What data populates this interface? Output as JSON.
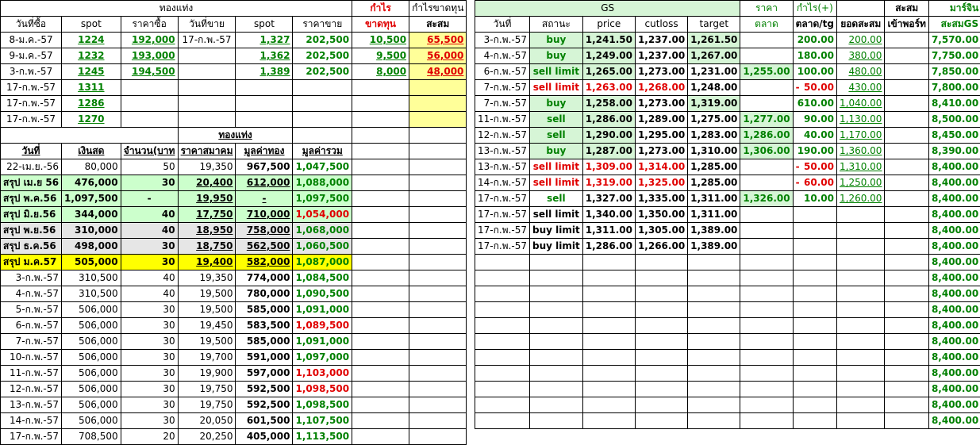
{
  "left": {
    "group_header": "ทองแท่ง",
    "group_profit": "กำไร",
    "group_profit_cum": "กำไรขาดทุน",
    "headers": [
      "วันที่ซื้อ",
      "spot",
      "ราคาซื้อ",
      "วันที่ขาย",
      "spot",
      "ราคาขาย",
      "ขาดทุน",
      "สะสม"
    ],
    "trades": [
      [
        "8-ม.ค.-57",
        "1224",
        "192,000",
        "17-ก.พ.-57",
        "1,327",
        "202,500",
        "10,500",
        "65,500"
      ],
      [
        "9-ม.ค.-57",
        "1232",
        "193,000",
        "",
        "1,362",
        "202,500",
        "9,500",
        "56,000"
      ],
      [
        "3-ก.พ.-57",
        "1245",
        "194,500",
        "",
        "1,389",
        "202,500",
        "8,000",
        "48,000"
      ],
      [
        "17-ก.พ.-57",
        "1311",
        "",
        "",
        "",
        "",
        "",
        ""
      ],
      [
        "17-ก.พ.-57",
        "1286",
        "",
        "",
        "",
        "",
        "",
        ""
      ],
      [
        "17-ก.พ.-57",
        "1270",
        "",
        "",
        "",
        "",
        "",
        ""
      ]
    ],
    "summary_group": "ทองแท่ง",
    "summary_headers": [
      "วันที่",
      "เงินสด",
      "จำนวน(บาท",
      "ราคาสมาคม",
      "มูลค่าทอง",
      "มูลค่ารวม"
    ],
    "summary_rows": [
      [
        "22-เม.ย.-56",
        "80,000",
        "50",
        "19,350",
        "967,500",
        "1,047,500"
      ],
      [
        "สรุป เม.ย 56",
        "476,000",
        "30",
        "20,400",
        "612,000",
        "1,088,000"
      ],
      [
        "สรุป พ.ค.56",
        "1,097,500",
        "-",
        "19,950",
        "-",
        "1,097,500"
      ],
      [
        "สรุป มิ.ย.56",
        "344,000",
        "40",
        "17,750",
        "710,000",
        "1,054,000"
      ],
      [
        "สรุป พ.ย.56",
        "310,000",
        "40",
        "18,950",
        "758,000",
        "1,068,000"
      ],
      [
        "สรุป ธ.ค.56",
        "498,000",
        "30",
        "18,750",
        "562,500",
        "1,060,500"
      ],
      [
        "สรุป ม.ค.57",
        "505,000",
        "30",
        "19,400",
        "582,000",
        "1,087,000"
      ],
      [
        "3-ก.พ.-57",
        "310,500",
        "40",
        "19,350",
        "774,000",
        "1,084,500"
      ],
      [
        "4-ก.พ.-57",
        "310,500",
        "40",
        "19,500",
        "780,000",
        "1,090,500"
      ],
      [
        "5-ก.พ.-57",
        "506,000",
        "30",
        "19,500",
        "585,000",
        "1,091,000"
      ],
      [
        "6-ก.พ.-57",
        "506,000",
        "30",
        "19,450",
        "583,500",
        "1,089,500"
      ],
      [
        "7-ก.พ.-57",
        "506,000",
        "30",
        "19,500",
        "585,000",
        "1,091,000"
      ],
      [
        "10-ก.พ.-57",
        "506,000",
        "30",
        "19,700",
        "591,000",
        "1,097,000"
      ],
      [
        "11-ก.พ.-57",
        "506,000",
        "30",
        "19,900",
        "597,000",
        "1,103,000"
      ],
      [
        "12-ก.พ.-57",
        "506,000",
        "30",
        "19,750",
        "592,500",
        "1,098,500"
      ],
      [
        "13-ก.พ.-57",
        "506,000",
        "30",
        "19,750",
        "592,500",
        "1,098,500"
      ],
      [
        "14-ก.พ.-57",
        "506,000",
        "30",
        "20,050",
        "601,500",
        "1,107,500"
      ],
      [
        "17-ก.พ.-57",
        "708,500",
        "20",
        "20,250",
        "405,000",
        "1,113,500"
      ]
    ]
  },
  "right": {
    "group_header": "GS",
    "price_group": "ราคา",
    "price_sub": "ตลาด",
    "profit_group": "กำไร(+)",
    "cum_group": "สะสม",
    "margin_group": "มาร์จิน",
    "headers": [
      "วันที่",
      "สถานะ",
      "price",
      "cutloss",
      "target",
      "",
      "ตลาด/tg",
      "ยอดสะสม",
      "เข้าพอร์ท",
      "สะสมGS"
    ],
    "rows": [
      [
        "3-ก.พ.-57",
        "buy",
        "1,241.50",
        "1,237.00",
        "1,261.50",
        "",
        "200.00",
        "200.00",
        "",
        "7,570.00"
      ],
      [
        "4-ก.พ.-57",
        "buy",
        "1,249.00",
        "1,237.00",
        "1,267.00",
        "",
        "180.00",
        "380.00",
        "",
        "7,750.00"
      ],
      [
        "6-ก.พ.-57",
        "sell limit",
        "1,265.00",
        "1,273.00",
        "1,231.00",
        "1,255.00",
        "100.00",
        "480.00",
        "",
        "7,850.00"
      ],
      [
        "7-ก.พ.-57",
        "sell limit",
        "1,263.00",
        "1,268.00",
        "1,248.00",
        "",
        "50.00",
        "430.00",
        "",
        "7,800.00"
      ],
      [
        "7-ก.พ.-57",
        "buy",
        "1,258.00",
        "1,273.00",
        "1,319.00",
        "",
        "610.00",
        "1,040.00",
        "",
        "8,410.00"
      ],
      [
        "11-ก.พ.-57",
        "sell",
        "1,286.00",
        "1,289.00",
        "1,275.00",
        "1,277.00",
        "90.00",
        "1,130.00",
        "",
        "8,500.00"
      ],
      [
        "12-ก.พ.-57",
        "sell",
        "1,290.00",
        "1,295.00",
        "1,283.00",
        "1,286.00",
        "40.00",
        "1,170.00",
        "",
        "8,450.00"
      ],
      [
        "13-ก.พ.-57",
        "buy",
        "1,287.00",
        "1,273.00",
        "1,310.00",
        "1,306.00",
        "190.00",
        "1,360.00",
        "",
        "8,390.00"
      ],
      [
        "13-ก.พ.-57",
        "sell limit",
        "1,309.00",
        "1,314.00",
        "1,285.00",
        "",
        "50.00",
        "1,310.00",
        "",
        "8,400.00"
      ],
      [
        "14-ก.พ.-57",
        "sell limit",
        "1,319.00",
        "1,325.00",
        "1,285.00",
        "",
        "60.00",
        "1,250.00",
        "",
        "8,400.00"
      ],
      [
        "17-ก.พ.-57",
        "sell",
        "1,327.00",
        "1,335.00",
        "1,311.00",
        "1,326.00",
        "10.00",
        "1,260.00",
        "",
        "8,400.00"
      ],
      [
        "17-ก.พ.-57",
        "sell limit",
        "1,340.00",
        "1,350.00",
        "1,311.00",
        "",
        "",
        "",
        "",
        "8,400.00"
      ],
      [
        "17-ก.พ.-57",
        "buy limit",
        "1,311.00",
        "1,305.00",
        "1,389.00",
        "",
        "",
        "",
        "",
        "8,400.00"
      ],
      [
        "17-ก.พ.-57",
        "buy limit",
        "1,286.00",
        "1,266.00",
        "1,389.00",
        "",
        "",
        "",
        "",
        "8,400.00"
      ]
    ],
    "tail_value": "8,400.00",
    "negative_dash": "-"
  }
}
